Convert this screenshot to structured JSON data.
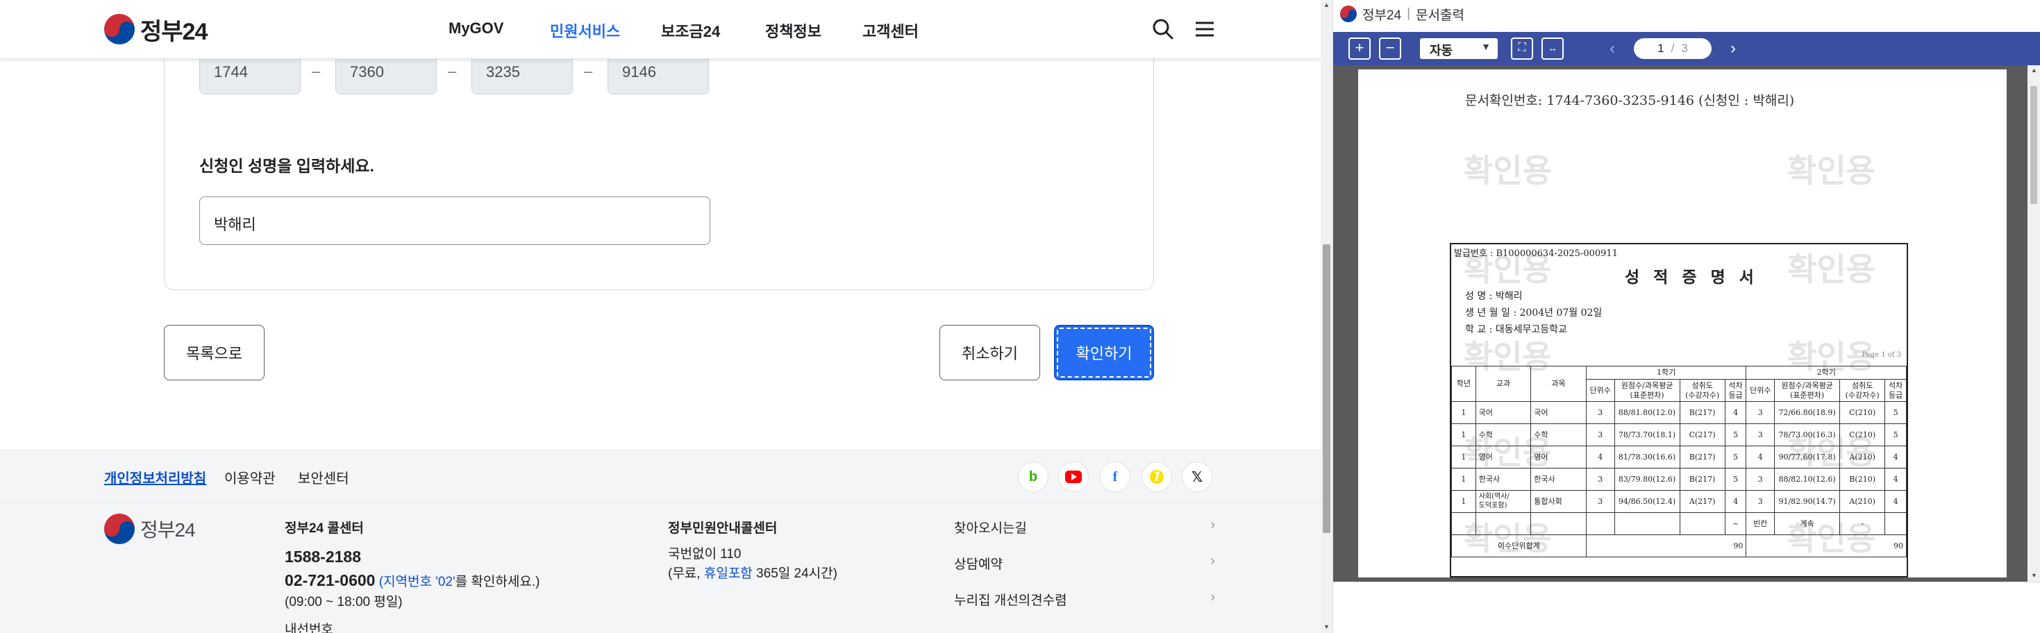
{
  "gov24": {
    "logo_text": "정부24",
    "nav": [
      "MyGOV",
      "민원서비스",
      "보조금24",
      "정책정보",
      "고객센터"
    ],
    "doc_number_parts": [
      "1744",
      "7360",
      "3235",
      "9146"
    ],
    "dash": "–",
    "name_label": "신청인 성명을 입력하세요.",
    "name_value": "박해리",
    "buttons": {
      "list": "목록으로",
      "cancel": "취소하기",
      "confirm": "확인하기"
    },
    "footer_links": [
      "개인정보처리방침",
      "이용약관",
      "보안센터"
    ],
    "sns_icons": [
      "blog-icon",
      "youtube-icon",
      "facebook-icon",
      "kakao-icon",
      "x-icon"
    ],
    "footer": {
      "logo_text": "정부24",
      "call_center_title": "정부24 콜센터",
      "call_center_number": "1588-2188",
      "call_center_number2": "02-721-0600",
      "area_code_note_pre": "(",
      "area_code_note_link": "지역번호 '02'",
      "area_code_note_post": "를 확인하세요.)",
      "hours": "(09:00 ~ 18:00 평일)",
      "cut_text": "내선번호",
      "guide_center_title": "정부민원안내콜센터",
      "guide_center_number": "국번없이 110",
      "guide_center_note_pre": "(무료, ",
      "guide_center_note_link": "휴일포함",
      "guide_center_note_post": " 365일 24시간)",
      "links": [
        "찾아오시는길",
        "상담예약",
        "누리집 개선의견수렴"
      ]
    }
  },
  "viewer": {
    "title_logo": "정부24",
    "title_sep": "|",
    "title": "문서출력",
    "zoom_mode": "자동",
    "current_page": "1",
    "page_sep": "/",
    "total_pages": "3",
    "doc_confirm_no": "문서확인번호: 1744-7360-3235-9146 (신청인 : 박해리)",
    "watermark": "확인용",
    "certificate": {
      "issue_no": "발급번호 : B100000634-2025-000911",
      "title": "성 적 증 명 서",
      "name_line": "성          명 : 박해리",
      "birth_line": "생  년  월  일 : 2004년 07월 02일",
      "school_line": "학          교 : 대동세무고등학교",
      "page_info": "Page 1 of 3",
      "sem1": "1학기",
      "sem2": "2학기",
      "headers": [
        "학년",
        "교과",
        "과목",
        "단위수",
        "원점수/과목평균\n(표준편차)",
        "성취도\n(수강자수)",
        "석차\n등급",
        "단위수",
        "원점수/과목평균\n(표준편차)",
        "성취도\n(수강자수)",
        "석차\n등급"
      ],
      "rows": [
        [
          "1",
          "국어",
          "국어",
          "3",
          "88/81.80(12.0)",
          "B(217)",
          "4",
          "3",
          "72/66.80(18.9)",
          "C(210)",
          "5"
        ],
        [
          "1",
          "수학",
          "수학",
          "3",
          "78/73.70(18.1)",
          "C(217)",
          "5",
          "3",
          "78/73.00(16.3)",
          "C(210)",
          "5"
        ],
        [
          "1",
          "영어",
          "영어",
          "4",
          "81/78.30(16.6)",
          "B(217)",
          "5",
          "4",
          "90/77.60(17.8)",
          "A(210)",
          "4"
        ],
        [
          "1",
          "한국사",
          "한국사",
          "3",
          "83/79.80(12.6)",
          "B(217)",
          "5",
          "3",
          "88/82.10(12.6)",
          "B(210)",
          "4"
        ],
        [
          "1",
          "사회(역사/\n도덕포함)",
          "통합사회",
          "3",
          "94/86.50(12.4)",
          "A(217)",
          "4",
          "3",
          "91/82.90(14.7)",
          "A(210)",
          "4"
        ]
      ],
      "empty_row": [
        "~",
        "빈칸",
        "계속",
        "-"
      ],
      "total_label": "이수단위합계",
      "total_sem1": "90",
      "total_sem2": "90"
    }
  }
}
